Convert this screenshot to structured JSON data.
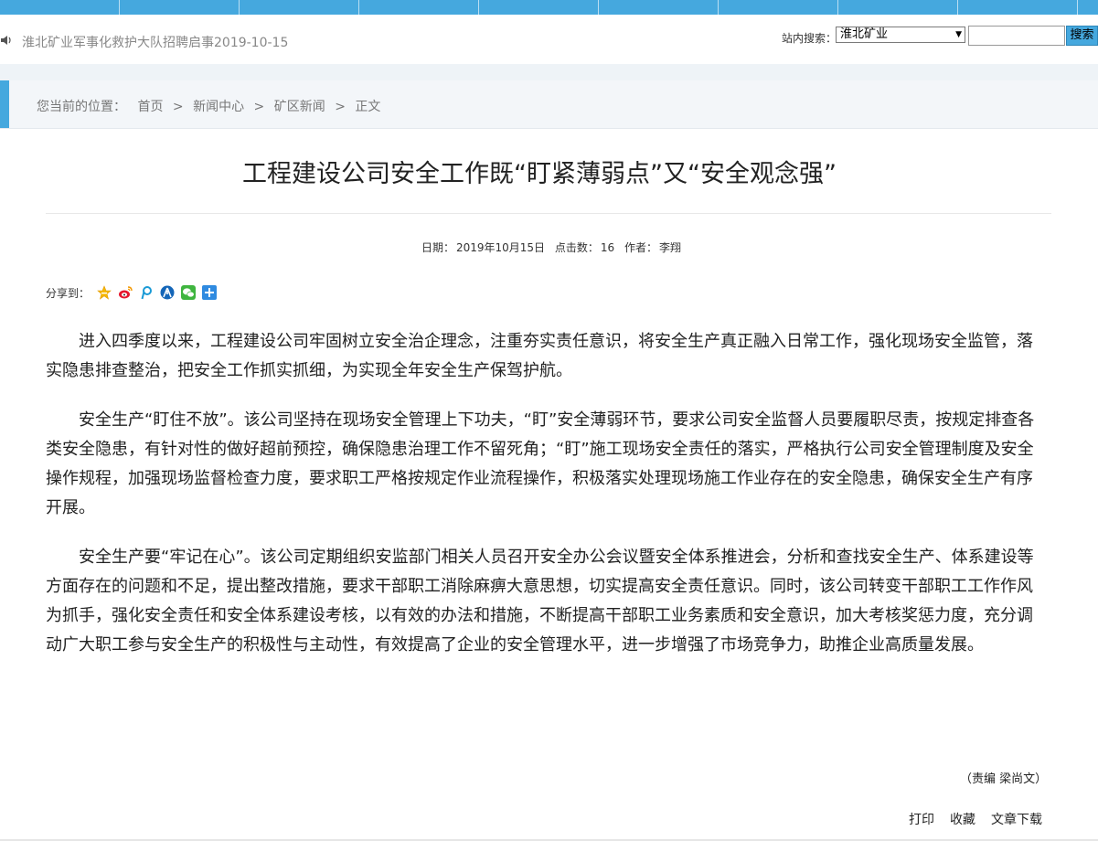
{
  "ticker": {
    "text": "淮北矿业军事化救护大队招聘启事2019-10-15"
  },
  "search": {
    "label": "站内搜索：",
    "scope_selected": "淮北矿业",
    "query": "",
    "button": "搜索"
  },
  "breadcrumb": {
    "prefix": "您当前的位置：",
    "items": [
      "首页",
      "新闻中心",
      "矿区新闻",
      "正文"
    ],
    "separator": ">"
  },
  "article": {
    "title": "工程建设公司安全工作既“盯紧薄弱点”又“安全观念强”",
    "meta": {
      "date_label": "日期：",
      "date": "2019年10月15日",
      "clicks_label": "点击数：",
      "clicks": "16",
      "author_label": "作者：",
      "author": "李翔"
    },
    "share_label": "分享到：",
    "share_icons": [
      "qzone-icon",
      "weibo-icon",
      "pengyou-icon",
      "renren-icon",
      "wechat-icon",
      "more-share-icon"
    ],
    "paragraphs": [
      "进入四季度以来，工程建设公司牢固树立安全治企理念，注重夯实责任意识，将安全生产真正融入日常工作，强化现场安全监管，落实隐患排查整治，把安全工作抓实抓细，为实现全年安全生产保驾护航。",
      "安全生产“盯住不放”。该公司坚持在现场安全管理上下功夫，“盯”安全薄弱环节，要求公司安全监督人员要履职尽责，按规定排查各类安全隐患，有针对性的做好超前预控，确保隐患治理工作不留死角；“盯”施工现场安全责任的落实，严格执行公司安全管理制度及安全操作规程，加强现场监督检查力度，要求职工严格按规定作业流程操作，积极落实处理现场施工作业存在的安全隐患，确保安全生产有序开展。",
      "安全生产要“牢记在心”。该公司定期组织安监部门相关人员召开安全办公会议暨安全体系推进会，分析和查找安全生产、体系建设等方面存在的问题和不足，提出整改措施，要求干部职工消除麻痹大意思想，切实提高安全责任意识。同时，该公司转变干部职工工作作风为抓手，强化安全责任和安全体系建设考核，以有效的办法和措施，不断提高干部职工业务素质和安全意识，加大考核奖惩力度，充分调动广大职工参与安全生产的积极性与主动性，有效提高了企业的安全管理水平，进一步增强了市场竞争力，助推企业高质量发展。"
    ],
    "editor": "（责编 梁尚文）"
  },
  "footer": {
    "print": "打印",
    "favorite": "收藏",
    "download": "文章下载"
  },
  "colors": {
    "accent": "#45a8de",
    "crumb_bg": "#f3f6f9"
  }
}
